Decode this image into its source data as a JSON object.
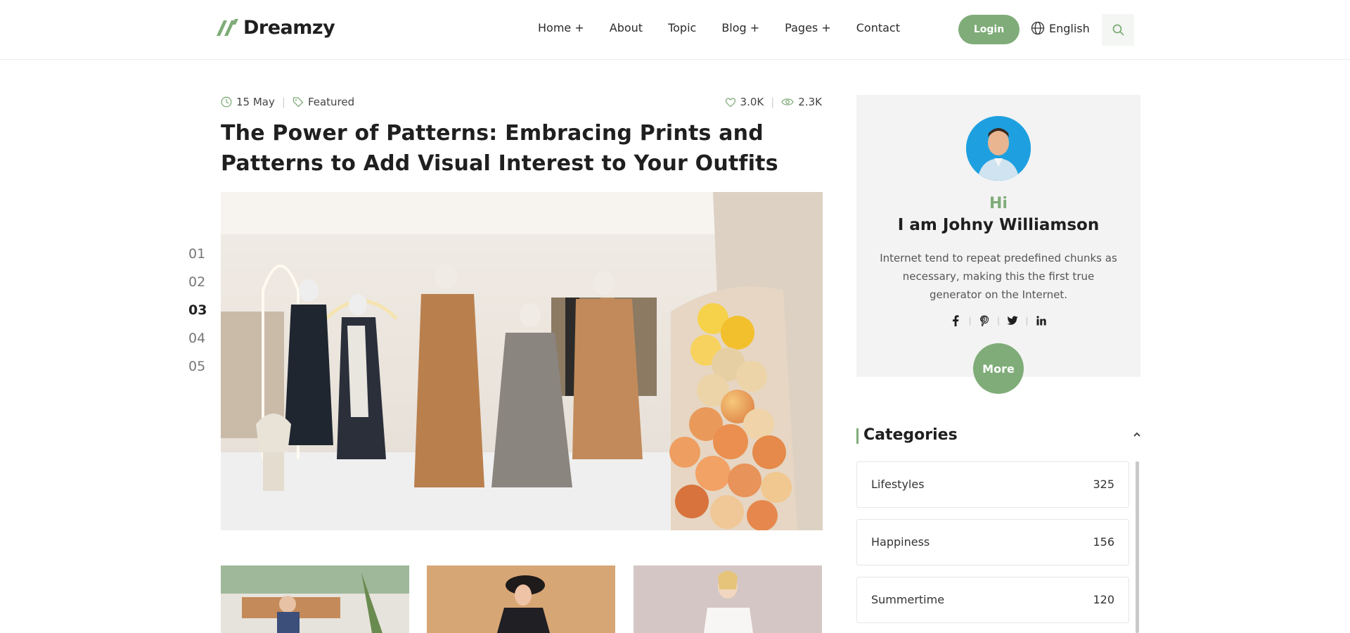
{
  "brand": {
    "name": "Dreamzy",
    "accent": "#7fac78"
  },
  "nav": {
    "items": [
      {
        "label": "Home +"
      },
      {
        "label": "About"
      },
      {
        "label": "Topic"
      },
      {
        "label": "Blog +"
      },
      {
        "label": "Pages +"
      },
      {
        "label": "Contact"
      }
    ],
    "login_label": "Login",
    "language": "English",
    "search_icon": "search-icon"
  },
  "article": {
    "date": "15 May",
    "tag": "Featured",
    "likes": "3.0K",
    "views": "2.3K",
    "title": "The Power of Patterns: Embracing Prints and Patterns to Add Visual Interest to Your Outfits"
  },
  "slider": {
    "numbers": [
      "01",
      "02",
      "03",
      "04",
      "05"
    ],
    "active_index": 2
  },
  "profile": {
    "greeting": "Hi",
    "name": "I am Johny Williamson",
    "bio": "Internet tend to repeat predefined chunks as necessary, making this the first true generator on the Internet.",
    "socials": [
      "facebook-icon",
      "pinterest-icon",
      "twitter-icon",
      "linkedin-icon"
    ],
    "more_label": "More"
  },
  "categories": {
    "title": "Categories",
    "items": [
      {
        "name": "Lifestyles",
        "count": "325"
      },
      {
        "name": "Happiness",
        "count": "156"
      },
      {
        "name": "Summertime",
        "count": "120"
      }
    ]
  }
}
